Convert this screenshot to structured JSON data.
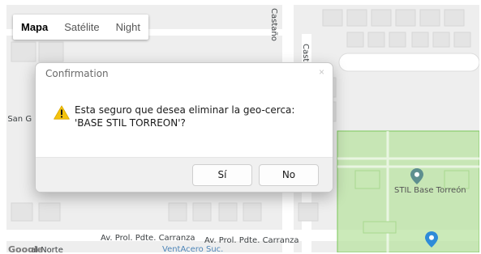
{
  "map": {
    "map_types": [
      {
        "label": "Mapa",
        "active": true
      },
      {
        "label": "Satélite",
        "active": false
      },
      {
        "label": "Night",
        "active": false
      }
    ],
    "streets": {
      "castano_1": "Castaño",
      "castano_2": "Casta",
      "san_left": "e San G",
      "carranza_1": "Av. Prol. Pdte. Carranza",
      "carranza_2": "Av. Prol. Pdte. Carranza",
      "del_norte": "al Norte",
      "ventacero": "VentAcero Suc."
    },
    "geofence_label": "STIL Base Torreón",
    "geofence_color": "#b9e3a1",
    "marker_color": "#5e8f8f",
    "logo_text": "Google"
  },
  "dialog": {
    "title": "Confirmation",
    "close_glyph": "×",
    "message": "Esta seguro que desea eliminar la geo-cerca: 'BASE STIL TORREON'?",
    "yes_label": "Sí",
    "no_label": "No"
  }
}
